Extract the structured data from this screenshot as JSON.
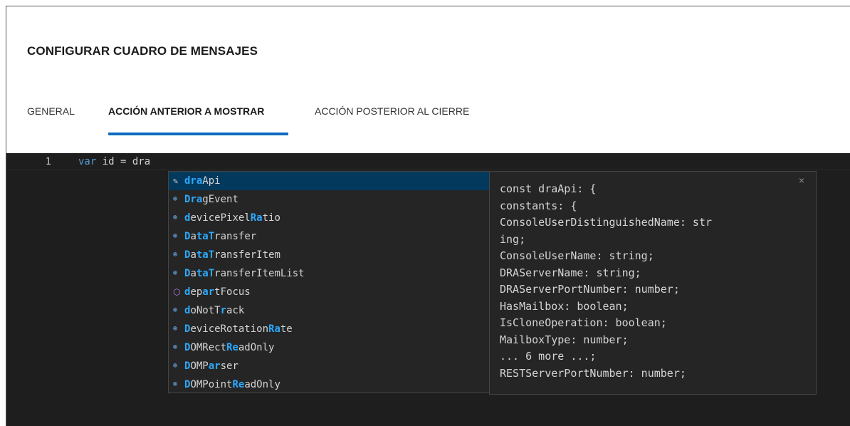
{
  "dialog": {
    "title": "CONFIGURAR CUADRO DE MENSAJES",
    "tabs": [
      {
        "label": "GENERAL",
        "active": false
      },
      {
        "label": "ACCIÓN ANTERIOR A MOSTRAR",
        "active": true
      },
      {
        "label": "ACCIÓN POSTERIOR AL CIERRE",
        "active": false
      }
    ],
    "accent_color": "#0f6cbd"
  },
  "editor": {
    "line_number": "1",
    "code_keyword": "var",
    "code_rest": " id = dra"
  },
  "suggestions": [
    {
      "icon": "wrench-icon",
      "pre": "",
      "match": "dra",
      "post": "Api",
      "selected": true
    },
    {
      "icon": "variable-icon",
      "pre": "",
      "match": "Dra",
      "post": "gEvent"
    },
    {
      "icon": "variable-icon",
      "pre": "",
      "match": "d",
      "post": "evicePixel",
      "match2": "Ra",
      "post2": "tio"
    },
    {
      "icon": "variable-icon",
      "pre": "",
      "match": "D",
      "post": "a",
      "match2": "taT",
      "post2": "ransfer"
    },
    {
      "icon": "variable-icon",
      "pre": "",
      "match": "D",
      "post": "a",
      "match2": "taT",
      "post2": "ransferItem"
    },
    {
      "icon": "variable-icon",
      "pre": "",
      "match": "D",
      "post": "a",
      "match2": "taT",
      "post2": "ransferItemList"
    },
    {
      "icon": "method-icon",
      "pre": "",
      "match": "d",
      "post": "ep",
      "match2": "ar",
      "post2": "tFocus"
    },
    {
      "icon": "variable-icon",
      "pre": "",
      "match": "d",
      "post": "oNotT",
      "match2": "r",
      "post2": "ack"
    },
    {
      "icon": "variable-icon",
      "pre": "",
      "match": "D",
      "post": "eviceRotation",
      "match2": "Ra",
      "post2": "te"
    },
    {
      "icon": "variable-icon",
      "pre": "",
      "match": "D",
      "post": "OMRect",
      "match2": "Re",
      "post2": "adOnly"
    },
    {
      "icon": "variable-icon",
      "pre": "",
      "match": "D",
      "post": "OMP",
      "match2": "ar",
      "post2": "ser"
    },
    {
      "icon": "variable-icon",
      "pre": "",
      "match": "D",
      "post": "OMPoint",
      "match2": "Re",
      "post2": "adOnly"
    }
  ],
  "details": {
    "close_glyph": "×",
    "lines": [
      "const draApi: {",
      "constants: {",
      "ConsoleUserDistinguishedName: str",
      "ing;",
      "ConsoleUserName: string;",
      "DRAServerName: string;",
      "DRAServerPortNumber: number;",
      "HasMailbox: boolean;",
      "IsCloneOperation: boolean;",
      "MailboxType: number;",
      "... 6 more ...;",
      "RESTServerPortNumber: number;"
    ]
  }
}
